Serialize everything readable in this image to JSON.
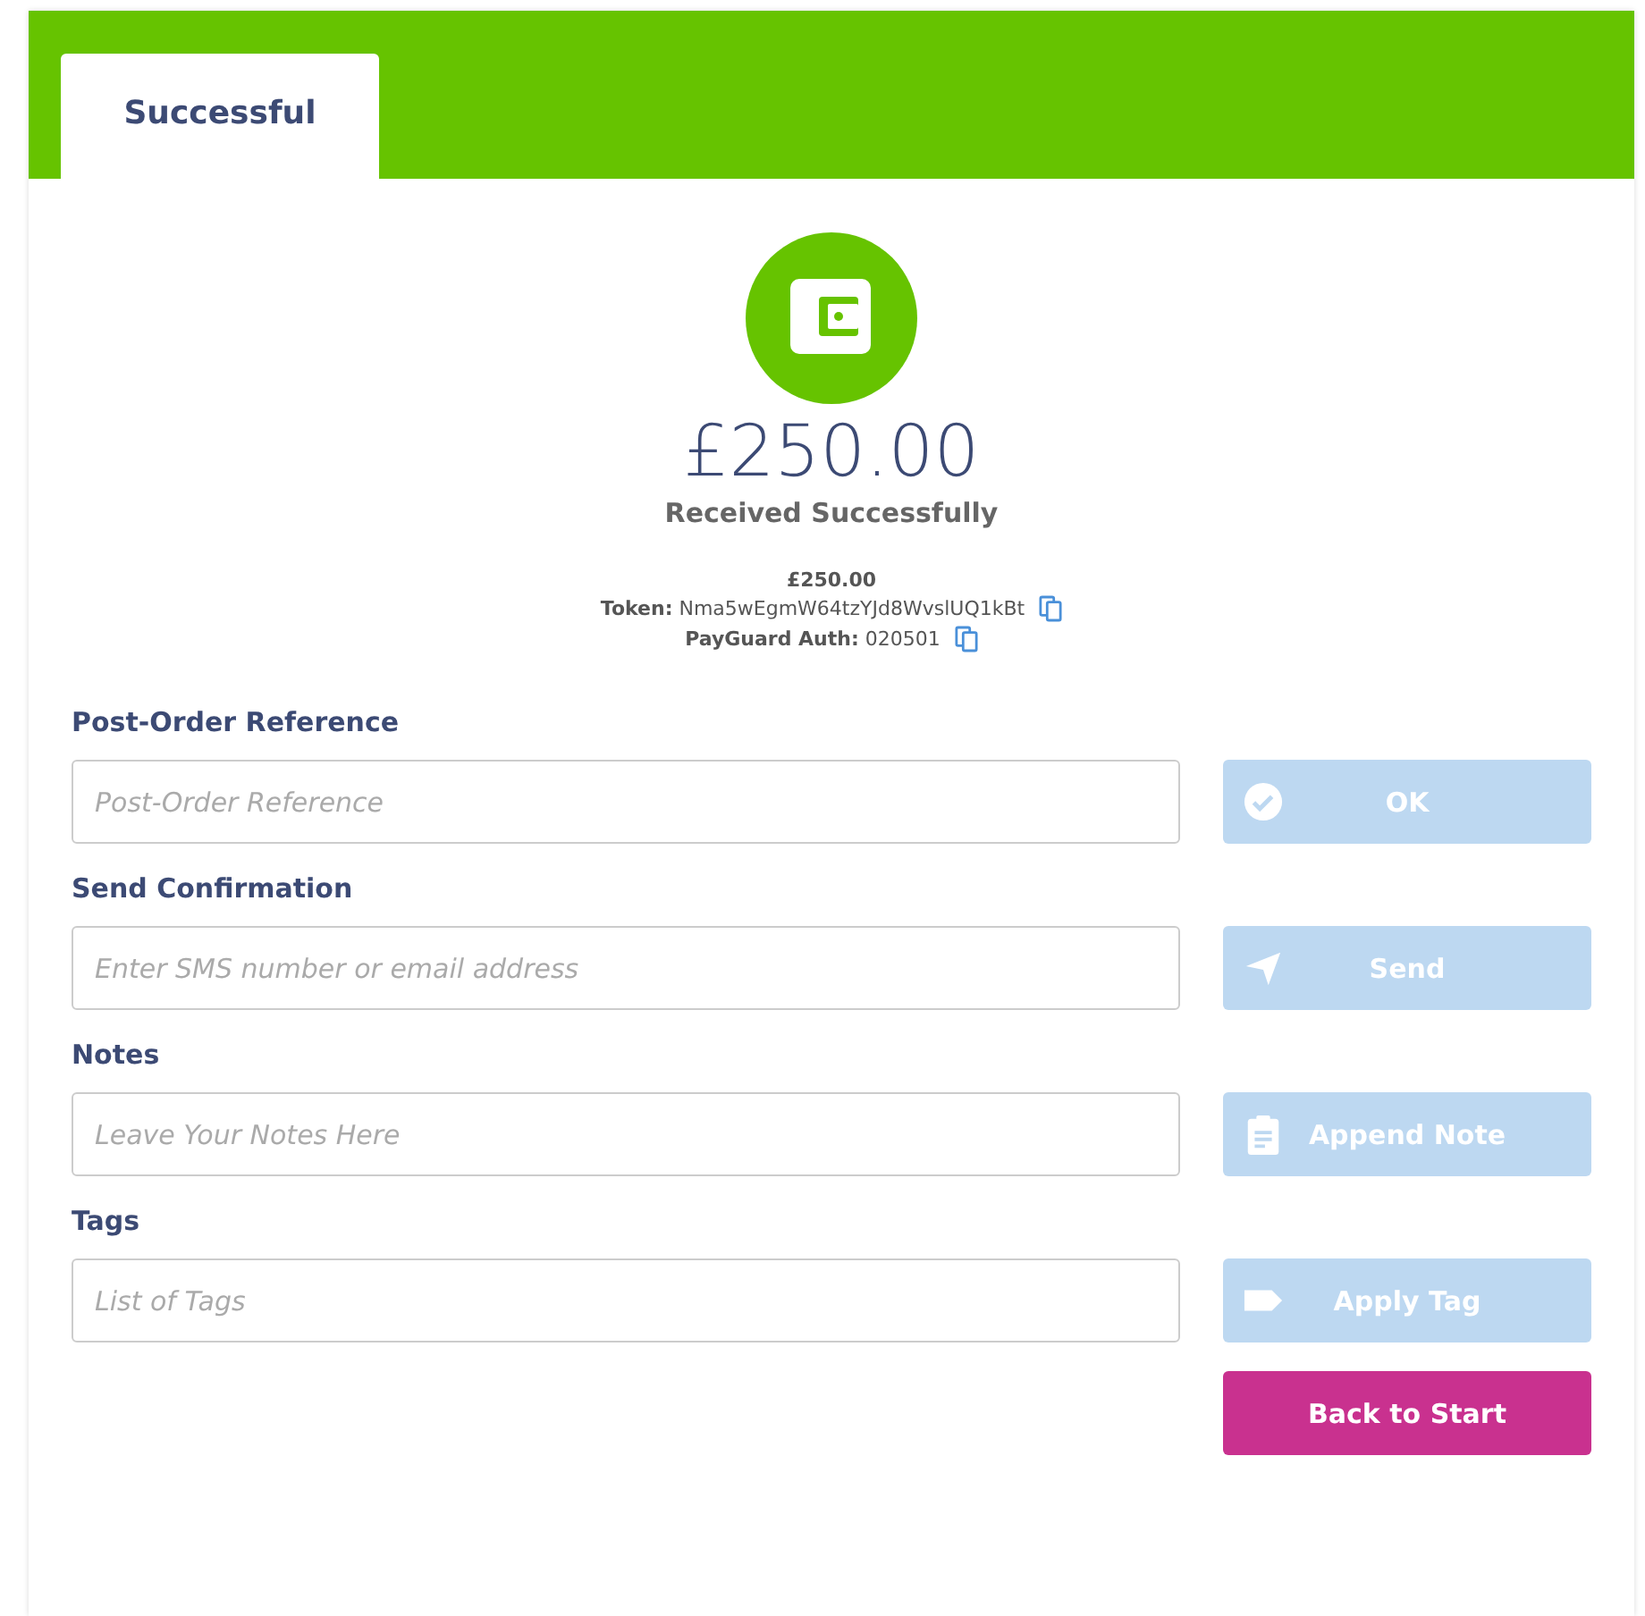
{
  "tabs": [
    {
      "label": "Successful",
      "selected": true
    }
  ],
  "summary": {
    "amount": "£250.00",
    "status": "Received Successfully",
    "detail_amount": "£250.00",
    "details": [
      {
        "label": "Token:",
        "value": "Nma5wEgmW64tzYJd8WvslUQ1kBt"
      },
      {
        "label": "PayGuard Auth:",
        "value": "020501"
      }
    ]
  },
  "fields": [
    {
      "label": "Post-Order Reference",
      "placeholder": "Post-Order Reference",
      "button": {
        "label": "OK",
        "kind": "check",
        "disabled": true
      }
    },
    {
      "label": "Send Confirmation",
      "placeholder": "Enter SMS number or email address",
      "button": {
        "label": "Send",
        "kind": "send",
        "disabled": true
      }
    },
    {
      "label": "Notes",
      "placeholder": "Leave Your Notes Here",
      "button": {
        "label": "Append Note",
        "kind": "note",
        "disabled": true
      }
    },
    {
      "label": "Tags",
      "placeholder": "List of Tags",
      "button": {
        "label": "Apply Tag",
        "kind": "tag",
        "disabled": true
      }
    }
  ],
  "back_button": {
    "label": "Back to Start",
    "disabled": false
  }
}
